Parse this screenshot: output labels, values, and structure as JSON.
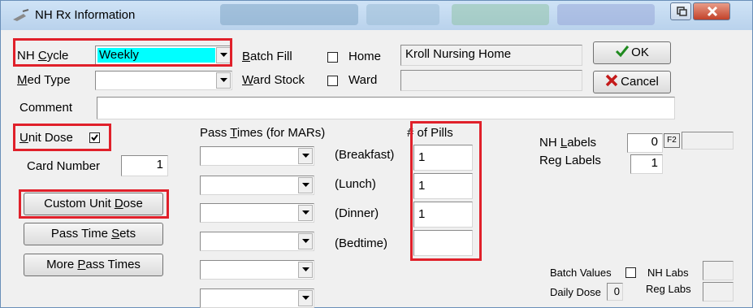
{
  "window": {
    "title": "NH Rx Information"
  },
  "nh_cycle": {
    "label_pre": "NH ",
    "label_ul": "C",
    "label_post": "ycle",
    "value": "Weekly"
  },
  "batch_fill": {
    "label_ul": "B",
    "label_post": "atch Fill"
  },
  "home": {
    "label": "Home",
    "value": "Kroll Nursing Home"
  },
  "ok": {
    "label": "OK"
  },
  "med_type": {
    "label_ul": "M",
    "label_post": "ed Type",
    "value": ""
  },
  "ward_stock": {
    "label_ul": "W",
    "label_post": "ard Stock"
  },
  "ward": {
    "label": "Ward",
    "value": ""
  },
  "cancel": {
    "label": "Cancel"
  },
  "comment": {
    "label": "Comment",
    "value": ""
  },
  "unit_dose": {
    "label_ul": "U",
    "label_post": "nit Dose",
    "checked": true
  },
  "card_number": {
    "label": "Card Number",
    "value": "1"
  },
  "pass_times": {
    "label_pre": "Pass ",
    "label_ul": "T",
    "label_post": "imes (for MARs)",
    "slots": [
      {
        "meal": "(Breakfast)",
        "pills": "1"
      },
      {
        "meal": "(Lunch)",
        "pills": "1"
      },
      {
        "meal": "(Dinner)",
        "pills": "1"
      },
      {
        "meal": "(Bedtime)",
        "pills": ""
      },
      {
        "meal": "",
        "pills": ""
      },
      {
        "meal": "",
        "pills": ""
      }
    ]
  },
  "pills_header": "# of Pills",
  "buttons": {
    "custom_unit_dose": {
      "pre": "Custom Unit ",
      "ul": "D",
      "post": "ose"
    },
    "pass_time_sets": {
      "pre": "Pass Time ",
      "ul": "S",
      "post": "ets"
    },
    "more_pass_times": {
      "pre": "More ",
      "ul": "P",
      "post": "ass Times"
    }
  },
  "nh_labels": {
    "label_pre": "NH ",
    "label_ul": "L",
    "label_post": "abels",
    "value": "0",
    "key": "F2"
  },
  "reg_labels": {
    "label": "Reg Labels",
    "value": "1"
  },
  "batch_values": {
    "label": "Batch Values"
  },
  "nh_labs": {
    "label": "NH Labs"
  },
  "daily_dose": {
    "label": "Daily Dose",
    "value": "0"
  },
  "reg_labs": {
    "label": "Reg Labs"
  },
  "colors": {
    "highlight": "#00ffff",
    "annotation_red": "#e0202a",
    "title_bar": "#c3daf2",
    "close_red": "#c2422a"
  }
}
